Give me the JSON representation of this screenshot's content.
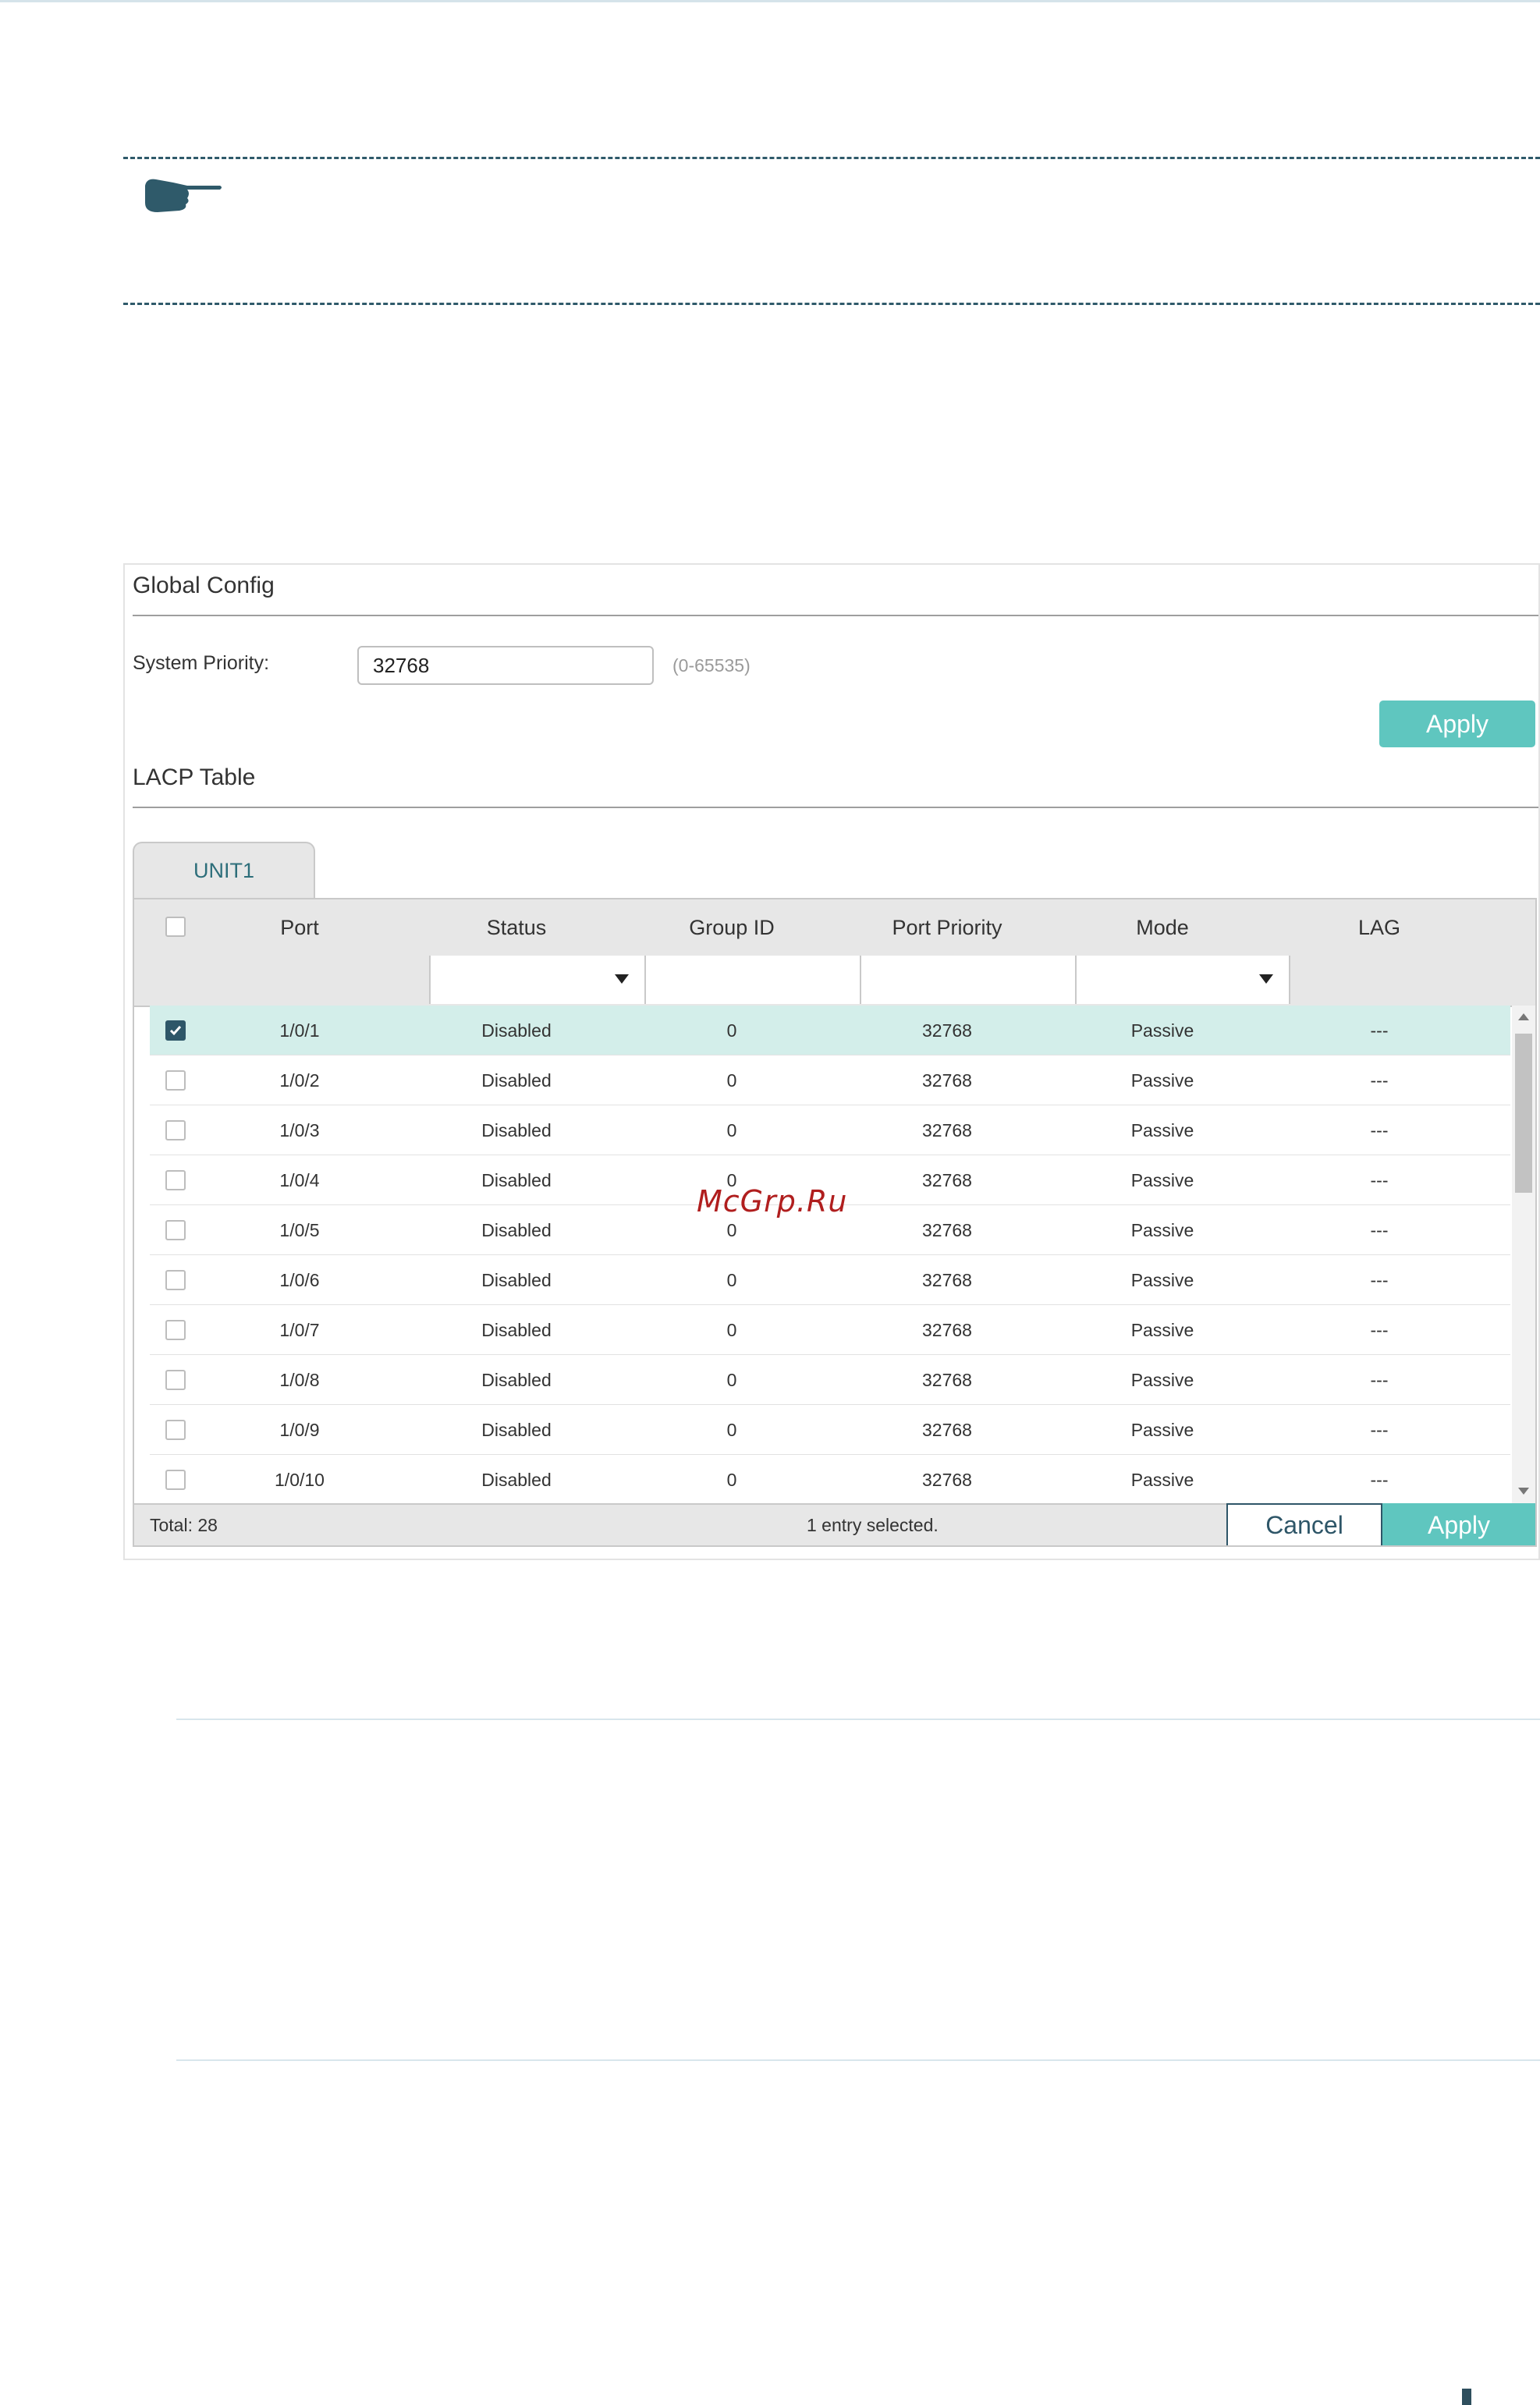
{
  "watermark": "McGrp.Ru",
  "global_config": {
    "title": "Global Config",
    "system_priority_label": "System Priority:",
    "system_priority_value": "32768",
    "range_hint": "(0-65535)",
    "apply_label": "Apply"
  },
  "lacp_table": {
    "title": "LACP Table",
    "tab_label": "UNIT1",
    "columns": [
      "Port",
      "Status",
      "Group ID",
      "Port Priority",
      "Mode",
      "LAG"
    ],
    "rows": [
      {
        "port": "1/0/1",
        "status": "Disabled",
        "group_id": "0",
        "port_priority": "32768",
        "mode": "Passive",
        "lag": "---",
        "checked": true
      },
      {
        "port": "1/0/2",
        "status": "Disabled",
        "group_id": "0",
        "port_priority": "32768",
        "mode": "Passive",
        "lag": "---",
        "checked": false
      },
      {
        "port": "1/0/3",
        "status": "Disabled",
        "group_id": "0",
        "port_priority": "32768",
        "mode": "Passive",
        "lag": "---",
        "checked": false
      },
      {
        "port": "1/0/4",
        "status": "Disabled",
        "group_id": "0",
        "port_priority": "32768",
        "mode": "Passive",
        "lag": "---",
        "checked": false
      },
      {
        "port": "1/0/5",
        "status": "Disabled",
        "group_id": "0",
        "port_priority": "32768",
        "mode": "Passive",
        "lag": "---",
        "checked": false
      },
      {
        "port": "1/0/6",
        "status": "Disabled",
        "group_id": "0",
        "port_priority": "32768",
        "mode": "Passive",
        "lag": "---",
        "checked": false
      },
      {
        "port": "1/0/7",
        "status": "Disabled",
        "group_id": "0",
        "port_priority": "32768",
        "mode": "Passive",
        "lag": "---",
        "checked": false
      },
      {
        "port": "1/0/8",
        "status": "Disabled",
        "group_id": "0",
        "port_priority": "32768",
        "mode": "Passive",
        "lag": "---",
        "checked": false
      },
      {
        "port": "1/0/9",
        "status": "Disabled",
        "group_id": "0",
        "port_priority": "32768",
        "mode": "Passive",
        "lag": "---",
        "checked": false
      },
      {
        "port": "1/0/10",
        "status": "Disabled",
        "group_id": "0",
        "port_priority": "32768",
        "mode": "Passive",
        "lag": "---",
        "checked": false
      }
    ],
    "total_label": "Total: 28",
    "selection_label": "1 entry selected.",
    "cancel_label": "Cancel",
    "apply_label": "Apply"
  },
  "colors": {
    "accent": "#5fc6bf",
    "dark": "#2e5668",
    "selected_row": "#d3eeea",
    "watermark": "#b01e1e"
  },
  "icons": {
    "note": "pointing-hand-icon",
    "check": "checkmark-icon",
    "dropdown": "caret-down-icon"
  }
}
